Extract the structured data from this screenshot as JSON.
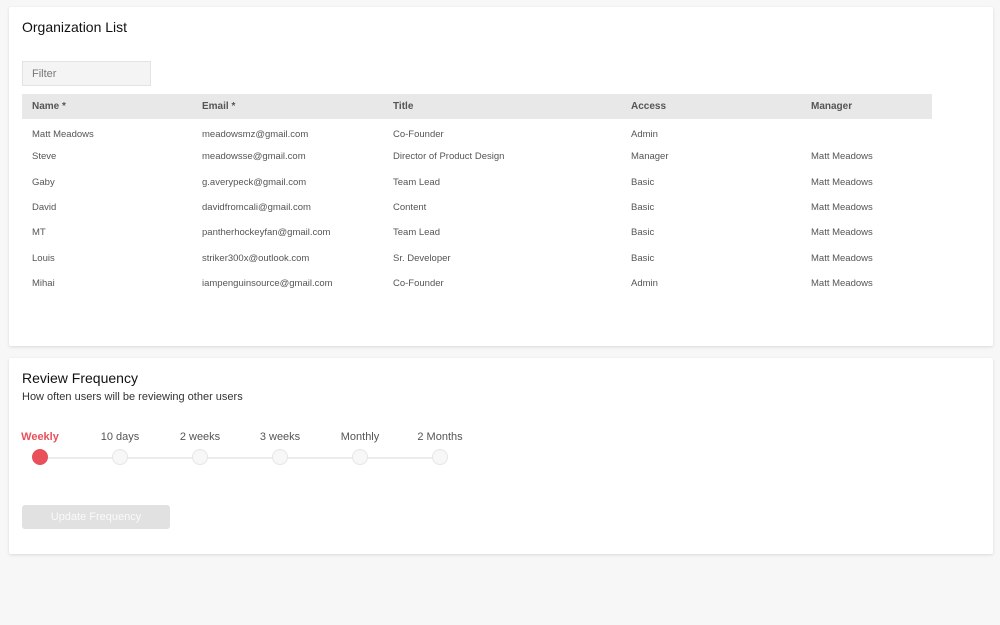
{
  "org_list": {
    "title": "Organization List",
    "filter_placeholder": "Filter",
    "columns": [
      "Name *",
      "Email *",
      "Title",
      "Access",
      "Manager"
    ],
    "rows": [
      {
        "name": "Matt Meadows",
        "email": "meadowsmz@gmail.com",
        "title": "Co-Founder",
        "access": "Admin",
        "manager": ""
      },
      {
        "name": "Steve",
        "email": "meadowsse@gmail.com",
        "title": "Director of Product Design",
        "access": "Manager",
        "manager": "Matt Meadows"
      },
      {
        "name": "Gaby",
        "email": "g.averypeck@gmail.com",
        "title": "Team Lead",
        "access": "Basic",
        "manager": "Matt Meadows"
      },
      {
        "name": "David",
        "email": "davidfromcali@gmail.com",
        "title": "Content",
        "access": "Basic",
        "manager": "Matt Meadows"
      },
      {
        "name": "MT",
        "email": "pantherhockeyfan@gmail.com",
        "title": "Team Lead",
        "access": "Basic",
        "manager": "Matt Meadows"
      },
      {
        "name": "Louis",
        "email": "striker300x@outlook.com",
        "title": "Sr. Developer",
        "access": "Basic",
        "manager": "Matt Meadows"
      },
      {
        "name": "Mihai",
        "email": "iampenguinsource@gmail.com",
        "title": "Co-Founder",
        "access": "Admin",
        "manager": "Matt Meadows"
      }
    ]
  },
  "review": {
    "title": "Review Frequency",
    "subtitle": "How often users will be reviewing other users",
    "options": [
      "Weekly",
      "10 days",
      "2 weeks",
      "3 weeks",
      "Monthly",
      "2 Months"
    ],
    "selected": "Weekly",
    "update_label": "Update Frequency"
  },
  "colors": {
    "accent": "#e8505b",
    "header_bg": "#e8e8e8",
    "page_bg": "#f7f7f7"
  }
}
